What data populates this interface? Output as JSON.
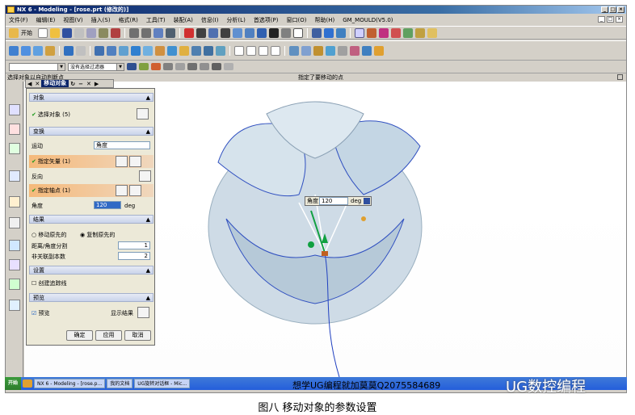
{
  "window": {
    "title": "NX 6 - Modeling - [rose.prt (修改的)]"
  },
  "menu": [
    "文件(F)",
    "编辑(E)",
    "视图(V)",
    "插入(S)",
    "格式(R)",
    "工具(T)",
    "装配(A)",
    "信息(I)",
    "分析(L)",
    "首选项(P)",
    "窗口(O)",
    "帮助(H)",
    "GM_MOULD(V5.0)"
  ],
  "toolbar": {
    "start_label": "开始",
    "filter_label": "没有选择过滤器"
  },
  "cue": {
    "left": "选择对象以自动判断点",
    "right": "指定了要移动的点"
  },
  "dialog": {
    "tab_title": "移动对象",
    "sections": {
      "objects": "对象",
      "transform": "变换",
      "result": "结果",
      "settings": "设置",
      "preview": "预览"
    },
    "select_objects": "选择对象 (5)",
    "motion_label": "运动",
    "motion_value": "角度",
    "specify_vector": "指定矢量 (1)",
    "reverse": "反向",
    "specify_axis_point": "指定轴点 (1)",
    "angle_label": "角度",
    "angle_value": "120",
    "angle_unit": "deg",
    "move_original": "移动原先的",
    "copy_original": "复制原先的",
    "distance_angle_div": "距离/角度分割",
    "distance_angle_div_value": "1",
    "non_associative_copies": "非关联副本数",
    "non_associative_copies_value": "2",
    "create_tracking_lines": "创建追踪线",
    "preview_label": "预览",
    "show_result": "显示结果",
    "ok": "确定",
    "apply": "应用",
    "cancel": "取消"
  },
  "popup": {
    "label": "角度",
    "value": "120",
    "unit": "deg"
  },
  "taskbar": {
    "start": "开始",
    "tasks": [
      "NX 6 - Modeling - [rose.p...",
      "我的文档",
      "UG旋转对话框 - Mic..."
    ]
  },
  "overlay_text": "想学UG编程就加莫莫Q2075584689",
  "watermark": "UG数控编程",
  "caption": "图八  移动对象的参数设置",
  "colors": {
    "accent": "#0a246a",
    "highlight": "#f5b97a",
    "model": "#b8ccdc"
  }
}
